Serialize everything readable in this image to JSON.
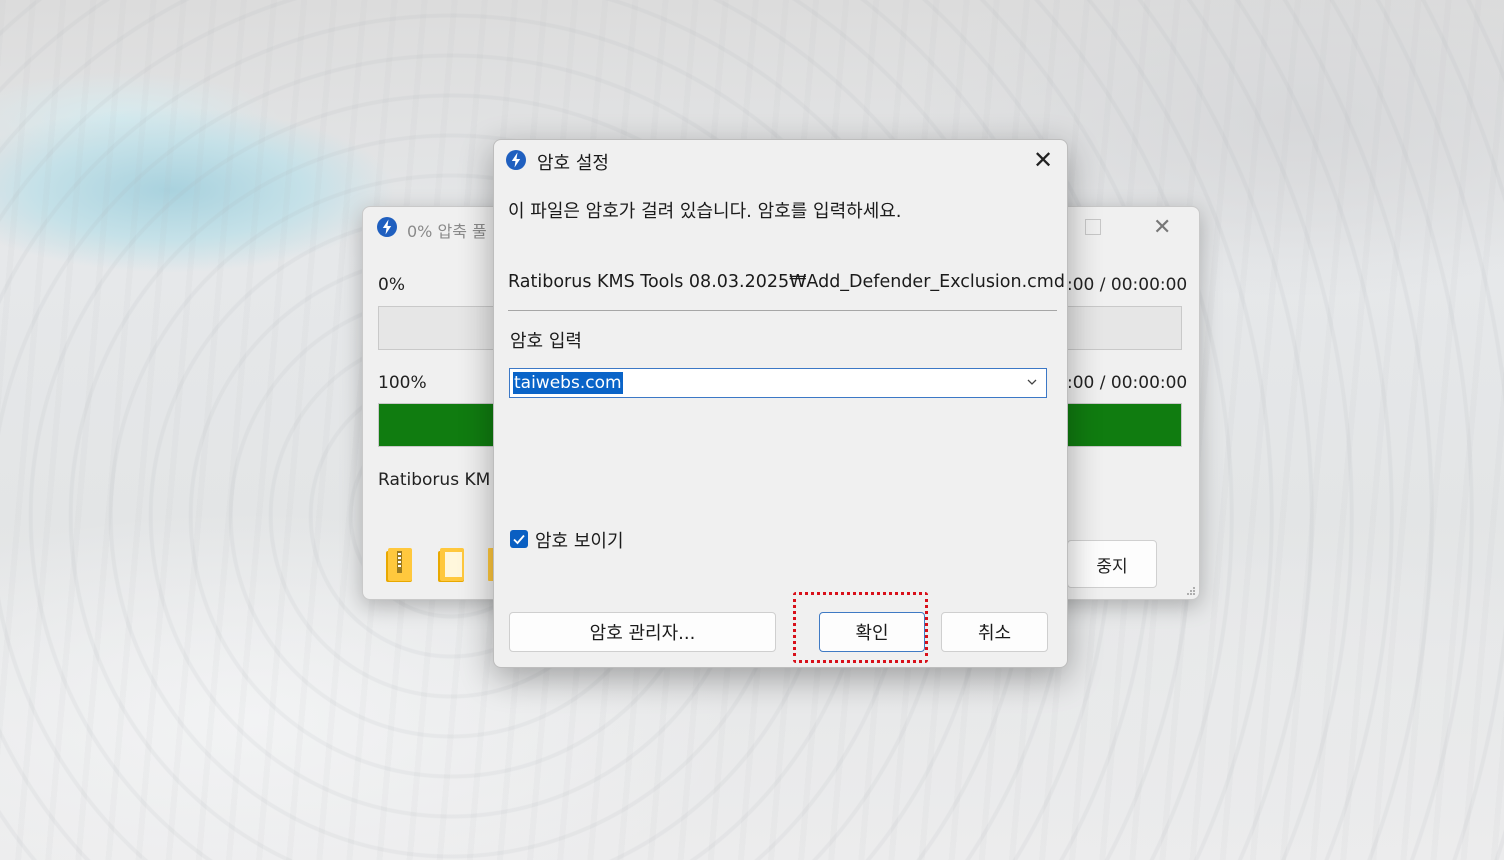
{
  "back_window": {
    "title": "0% 압축 풀",
    "progress_top_label": "0%",
    "progress_top_time": ":00 / 00:00:00",
    "progress_top_fraction": 0,
    "progress_bottom_label": "100%",
    "progress_bottom_time": ":00 / 00:00:00",
    "progress_bottom_fraction": 1,
    "file_label": "Ratiborus KM",
    "stop_label": "중지",
    "icons": [
      "zip-folder-icon",
      "folder-icon",
      "folder-icon"
    ]
  },
  "dialog": {
    "title": "암호 설정",
    "message": "이 파일은 암호가 걸려 있습니다. 암호를 입력하세요.",
    "file_path": "Ratiborus KMS Tools 08.03.2025₩Add_Defender_Exclusion.cmd",
    "password_label": "암호 입력",
    "password_value": "taiwebs.com",
    "show_password_label": "암호 보이기",
    "show_password_checked": true,
    "buttons": {
      "manager": "암호 관리자...",
      "ok": "확인",
      "cancel": "취소"
    }
  },
  "colors": {
    "progress_fill": "#107c10",
    "accent": "#0a5fc2",
    "highlight": "#d8101a"
  }
}
